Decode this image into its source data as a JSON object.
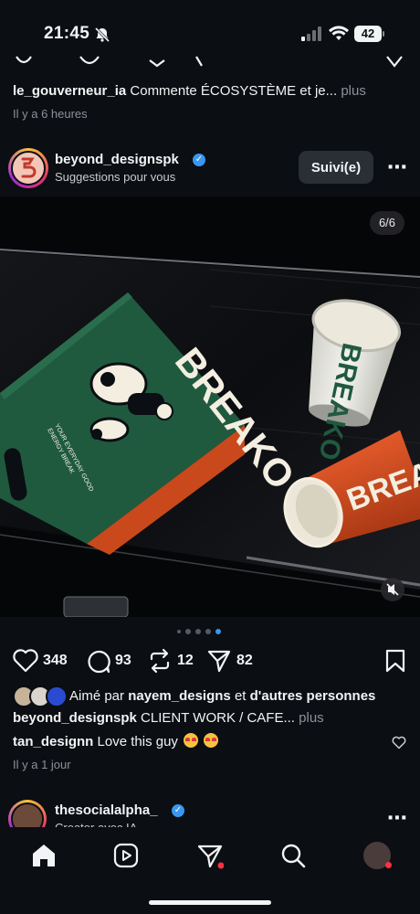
{
  "status_bar": {
    "time": "21:45",
    "battery": "42"
  },
  "previous_post": {
    "comment_user": "le_gouverneur_ia",
    "comment_text": "Commente ÉCOSYSTÈME et je...",
    "more_label": "plus",
    "time_ago": "Il y a 6 heures"
  },
  "post": {
    "username": "beyond_designspk",
    "subtitle": "Suggestions pour vous",
    "follow_label": "Suivi(e)",
    "more_icon": "⋯",
    "image_counter": "6/6",
    "image_brand_text": "BREAKO",
    "image_bag_tagline_1": "YOUR EVERYDAY GOOD",
    "image_bag_tagline_2": "ENERGY BREAK",
    "likes": "348",
    "comments": "93",
    "reposts": "12",
    "shares": "82",
    "liked_by_prefix": "Aimé par",
    "liked_by_user": "nayem_designs",
    "liked_by_suffix": "et",
    "liked_by_others": "d'autres personnes",
    "caption_user": "beyond_designspk",
    "caption_text": "CLIENT WORK / CAFE...",
    "caption_more": "plus",
    "top_comment_user": "tan_designn",
    "top_comment_text": "Love this guy",
    "time_ago": "Il y a 1 jour"
  },
  "next_post": {
    "username": "thesocialalpha_",
    "subtitle": "Creator avec IA"
  },
  "tabbar": {
    "items": [
      "home-icon",
      "reels-icon",
      "direct-icon",
      "search-icon",
      "profile-icon"
    ]
  },
  "colors": {
    "accent_blue": "#3897f0",
    "bag_green": "#1f5a3f",
    "cup_orange": "#d24a1f",
    "notification_red": "#ff3040"
  }
}
